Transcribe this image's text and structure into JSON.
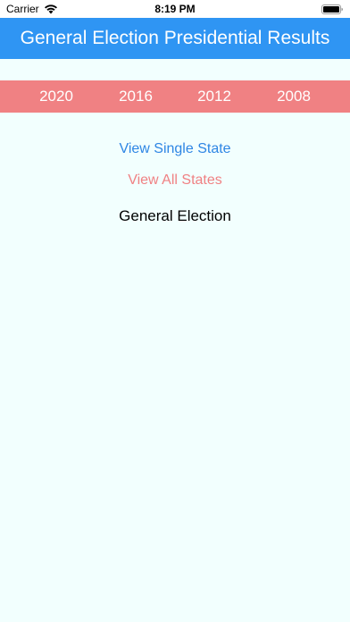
{
  "status_bar": {
    "carrier": "Carrier",
    "time": "8:19 PM",
    "wifi_icon": "wifi-icon",
    "battery_icon": "battery-icon"
  },
  "header": {
    "title": "General Election Presidential Results",
    "background_color": "#2f95f3"
  },
  "year_tabs": {
    "background_color": "#f08183",
    "items": [
      {
        "label": "2020"
      },
      {
        "label": "2016"
      },
      {
        "label": "2012"
      },
      {
        "label": "2008"
      }
    ]
  },
  "actions": {
    "view_single_state": "View Single State",
    "view_all_states": "View All States"
  },
  "section": {
    "label": "General Election"
  },
  "colors": {
    "background": "#f2fffe",
    "link_blue": "#2e86e4",
    "link_pink": "#f08183"
  }
}
